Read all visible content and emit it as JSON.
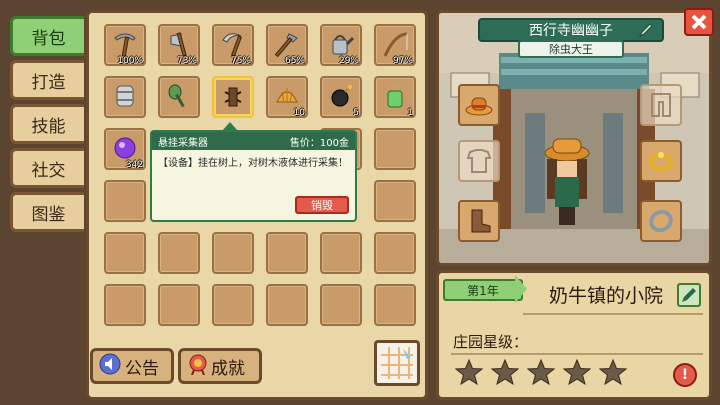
{
  "tabs": [
    {
      "label": "背包",
      "active": true
    },
    {
      "label": "打造",
      "active": false
    },
    {
      "label": "技能",
      "active": false
    },
    {
      "label": "社交",
      "active": false
    },
    {
      "label": "图鉴",
      "active": false
    }
  ],
  "inventory": {
    "row1": [
      {
        "icon": "pickaxe-icon",
        "count": "100%"
      },
      {
        "icon": "axe-icon",
        "count": "73%"
      },
      {
        "icon": "scythe-icon",
        "count": "75%"
      },
      {
        "icon": "hoe-icon",
        "count": "65%"
      },
      {
        "icon": "watering-can-icon",
        "count": "29%"
      },
      {
        "icon": "fishing-rod-icon",
        "count": "97%"
      }
    ],
    "row2": [
      {
        "icon": "barrel-icon",
        "count": ""
      },
      {
        "icon": "shovel-icon",
        "count": ""
      },
      {
        "icon": "tree-tapper-icon",
        "count": "",
        "selected": true
      },
      {
        "icon": "shell-icon",
        "count": "10"
      },
      {
        "icon": "bomb-icon",
        "count": "5"
      },
      {
        "icon": "potion-icon",
        "count": "1"
      }
    ],
    "row3": [
      {
        "icon": "purple-orb-icon",
        "count": "342"
      }
    ]
  },
  "tooltip": {
    "name": "悬挂采集器",
    "price": "售价：100金",
    "description": "【设备】挂在树上，对树木液体进行采集！",
    "destroy_label": "销毁"
  },
  "bottom": {
    "notice_label": "公告",
    "achievement_label": "成就"
  },
  "character": {
    "name": "西行寺幽幽子",
    "title": "除虫大王"
  },
  "farm": {
    "year_label": "第1年",
    "farm_name": "奶牛镇的小院",
    "rating_label": "庄园星级：",
    "stars_filled": 0,
    "stars_total": 5
  },
  "colors": {
    "tab_active": "#8fcf76",
    "name_bar": "#2d6d57",
    "destroy_button": "#e35b4b"
  }
}
